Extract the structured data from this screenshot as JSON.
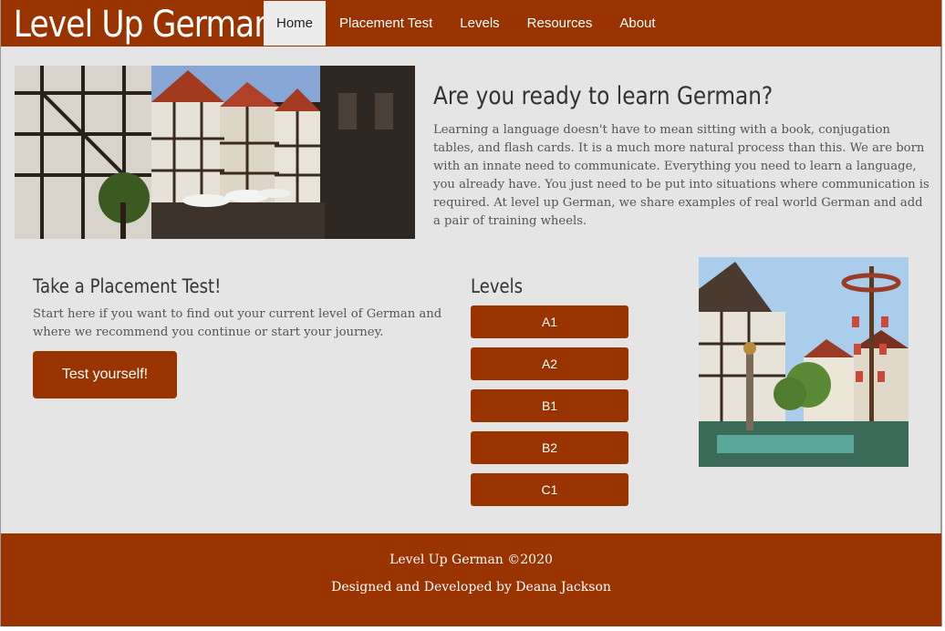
{
  "header": {
    "logo": "Level Up German",
    "nav": [
      {
        "label": "Home",
        "active": true
      },
      {
        "label": "Placement Test",
        "active": false
      },
      {
        "label": "Levels",
        "active": false
      },
      {
        "label": "Resources",
        "active": false
      },
      {
        "label": "About",
        "active": false
      }
    ]
  },
  "hero": {
    "title": "Are you ready to learn German?",
    "text": "Learning a language doesn't have to mean sitting with a book, conjugation tables, and flash cards. It is a much more natural process than this. We are born with an innate need to communicate. Everything you need to learn a language, you already have. You just need to be put into situations where communication is required. At level up German, we share examples of real world German and add a pair of training wheels."
  },
  "placement": {
    "title": "Take a Placement Test!",
    "text": "Start here if you want to find out your current level of German and where we recommend you continue or start your journey.",
    "button": "Test yourself!"
  },
  "levels": {
    "title": "Levels",
    "items": [
      "A1",
      "A2",
      "B1",
      "B2",
      "C1"
    ]
  },
  "footer": {
    "line1": "Level Up German ©2020",
    "line2": "Designed and Developed by Deana Jackson"
  },
  "colors": {
    "brand": "#993300",
    "background": "#e5e5e5"
  }
}
